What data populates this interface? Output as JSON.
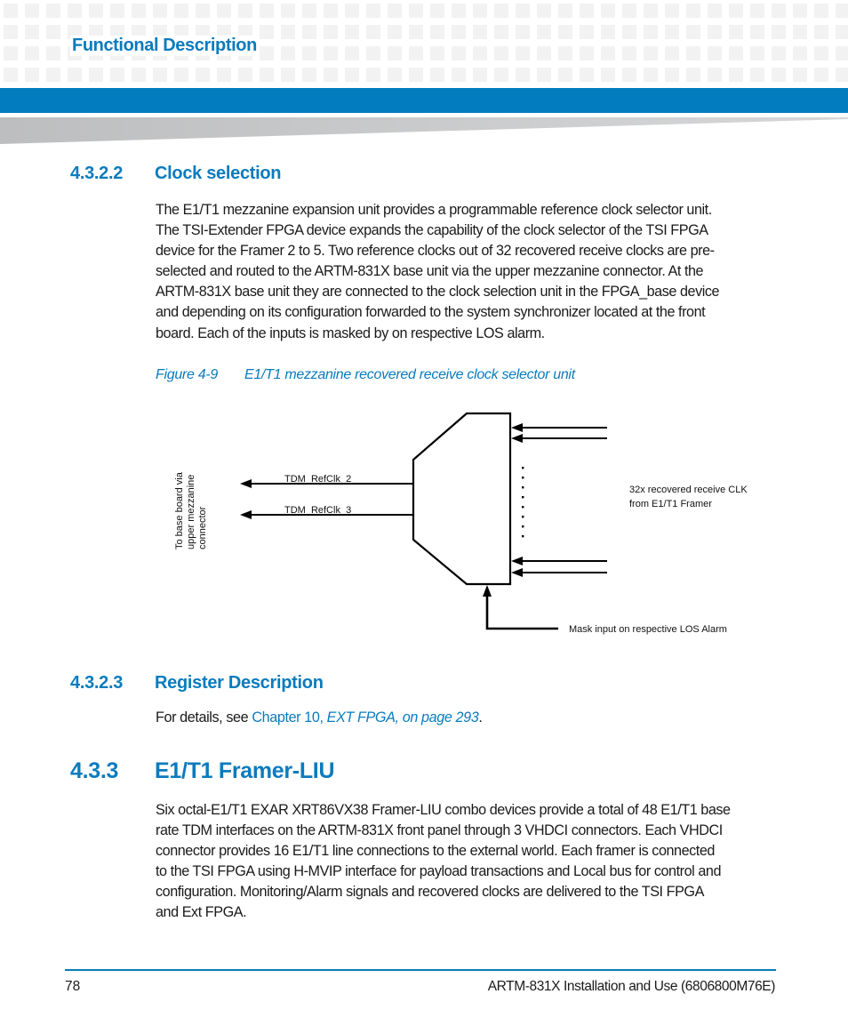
{
  "header": {
    "section_title": "Functional Description",
    "brand_color": "#027cbe"
  },
  "sections": [
    {
      "number": "4.3.2.2",
      "title": "Clock selection",
      "paragraph_lines": [
        "The E1/T1 mezzanine expansion unit provides a programmable reference clock selector unit.",
        "The TSI-Extender FPGA device expands the capability of the clock selector of the TSI FPGA",
        "device for the Framer 2 to 5. Two reference clocks out of 32 recovered receive clocks are pre-",
        "selected and routed to the ARTM-831X base unit via the upper mezzanine connector. At the",
        "ARTM-831X base unit they are connected to the clock selection unit in the FPGA_base device",
        "and depending on its configuration forwarded to the system synchronizer located at the front",
        "board. Each of the inputs is masked by on respective LOS alarm."
      ]
    },
    {
      "number": "4.3.2.3",
      "title": "Register Description",
      "text_prefix": "For details, see ",
      "link_chapter": "Chapter 10, ",
      "link_title": "EXT FPGA, on page 293",
      "text_suffix": "."
    },
    {
      "number": "4.3.3",
      "title": "E1/T1 Framer-LIU",
      "paragraph_lines": [
        "Six octal-E1/T1 EXAR XRT86VX38 Framer-LIU combo devices provide a total of 48 E1/T1 base",
        "rate TDM interfaces on the ARTM-831X front panel through 3 VHDCI connectors. Each VHDCI",
        "connector provides 16 E1/T1 line connections to the external world. Each framer is connected",
        "to the TSI FPGA using H-MVIP interface for payload transactions and Local bus for control and",
        "configuration. Monitoring/Alarm signals and recovered clocks are delivered to the TSI FPGA",
        "and Ext FPGA."
      ]
    }
  ],
  "figure": {
    "number": "Figure 4-9",
    "caption": "E1/T1 mezzanine recovered receive clock selector unit",
    "labels": {
      "output_1": "TDM_RefClk_2",
      "output_2": "TDM_RefClk_3",
      "left_vertical": [
        "To  base board via",
        "upper mezzanine",
        "connector"
      ],
      "inputs_line1": "32x recovered receive CLK",
      "inputs_line2": "from E1/T1 Framer",
      "mask": "Mask input on respective LOS Alarm"
    }
  },
  "footer": {
    "page_number": "78",
    "document": "ARTM-831X Installation and Use (6806800M76E)"
  }
}
